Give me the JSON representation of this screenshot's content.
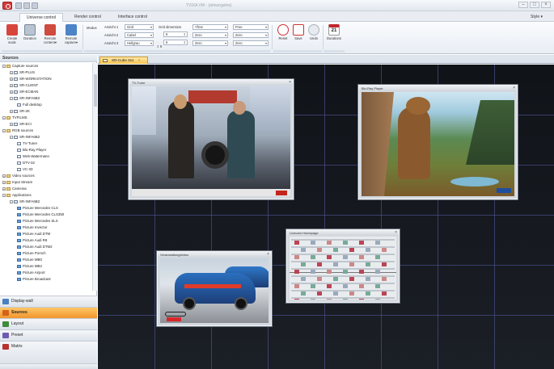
{
  "window": {
    "title": "TVIXA VM  - (ahnungslos)",
    "controls": [
      "–",
      "□",
      "×"
    ]
  },
  "tabs": [
    {
      "label": "Universe control",
      "active": true
    },
    {
      "label": "Render control",
      "active": false
    },
    {
      "label": "Interface control",
      "active": false
    }
  ],
  "style_menu": "Style ▾",
  "ribbon": {
    "buttons": [
      {
        "label": "Create scale"
      },
      {
        "label": "Duration"
      },
      {
        "label": "Remote content▾"
      },
      {
        "label": "Remote capture▾"
      }
    ],
    "settings_label": "Modus",
    "panel1": {
      "rows": [
        {
          "label": "Ansicht 1",
          "value": "Grid"
        },
        {
          "label": "Ansicht 2",
          "value": "Cabel"
        },
        {
          "label": "Ansicht 3",
          "value": "Hellgrau"
        }
      ]
    },
    "panel2": {
      "label": "Grid dimension",
      "spins": [
        "6",
        "6",
        "6"
      ]
    },
    "panel3": {
      "combos": [
        "Yfree",
        "Zero",
        "Zero"
      ]
    },
    "panel4": {
      "combos": [
        "Free",
        "Zero",
        "Zero"
      ]
    },
    "actions": [
      {
        "label": "Reset"
      },
      {
        "label": "Save"
      },
      {
        "label": "Undo"
      }
    ],
    "calendar": {
      "day": "21",
      "label": "Durations"
    }
  },
  "sidebar": {
    "header": "Sources",
    "tree": [
      {
        "depth": 0,
        "label": "Capture sources",
        "kind": "folder",
        "exp": "−"
      },
      {
        "depth": 1,
        "label": "SR-PLUS",
        "kind": "item",
        "exp": "+"
      },
      {
        "depth": 1,
        "label": "SR-WORKSTATION",
        "kind": "item",
        "exp": "+"
      },
      {
        "depth": 1,
        "label": "SR-CLIENT",
        "kind": "item",
        "exp": "+"
      },
      {
        "depth": 1,
        "label": "SR-ECMAN",
        "kind": "item",
        "exp": "+"
      },
      {
        "depth": 1,
        "label": "SR-INFA6B2",
        "kind": "item",
        "exp": "−"
      },
      {
        "depth": 2,
        "label": "Full desktop",
        "kind": "item",
        "exp": ""
      },
      {
        "depth": 1,
        "label": "SR-2K",
        "kind": "item",
        "exp": "+"
      },
      {
        "depth": 0,
        "label": "TVFILMS",
        "kind": "folder",
        "exp": "−"
      },
      {
        "depth": 1,
        "label": "SR-ECI",
        "kind": "item",
        "exp": "+"
      },
      {
        "depth": 0,
        "label": "RGB sources",
        "kind": "folder",
        "exp": "−"
      },
      {
        "depth": 1,
        "label": "SR-INFA6B2",
        "kind": "item",
        "exp": "−"
      },
      {
        "depth": 2,
        "label": "TV-Tuner",
        "kind": "item",
        "exp": ""
      },
      {
        "depth": 2,
        "label": "Blu-Ray Player",
        "kind": "item",
        "exp": ""
      },
      {
        "depth": 2,
        "label": "Web-Watermann",
        "kind": "item",
        "exp": ""
      },
      {
        "depth": 2,
        "label": "DTV-32",
        "kind": "item",
        "exp": ""
      },
      {
        "depth": 2,
        "label": "VC-33",
        "kind": "item",
        "exp": ""
      },
      {
        "depth": 0,
        "label": "Video sources",
        "kind": "folder",
        "exp": "+"
      },
      {
        "depth": 0,
        "label": "Input Stream",
        "kind": "folder",
        "exp": "+"
      },
      {
        "depth": 0,
        "label": "Cameras",
        "kind": "folder",
        "exp": "+"
      },
      {
        "depth": 0,
        "label": "Applications",
        "kind": "folder",
        "exp": "−"
      },
      {
        "depth": 1,
        "label": "SR-INFA6B2",
        "kind": "item",
        "exp": "−"
      },
      {
        "depth": 2,
        "label": "Picture Mercedes CLS",
        "kind": "pic",
        "exp": ""
      },
      {
        "depth": 2,
        "label": "Picture Mercedes CLS350",
        "kind": "pic",
        "exp": ""
      },
      {
        "depth": 2,
        "label": "Picture Mercedes SLS",
        "kind": "pic",
        "exp": ""
      },
      {
        "depth": 2,
        "label": "Picture Invector",
        "kind": "pic",
        "exp": ""
      },
      {
        "depth": 2,
        "label": "Picture Audi DTM",
        "kind": "pic",
        "exp": ""
      },
      {
        "depth": 2,
        "label": "Picture Audi R8",
        "kind": "pic",
        "exp": ""
      },
      {
        "depth": 2,
        "label": "Picture Audi DTM2",
        "kind": "pic",
        "exp": ""
      },
      {
        "depth": 2,
        "label": "Picture Porsch",
        "kind": "pic",
        "exp": ""
      },
      {
        "depth": 2,
        "label": "Picture MB0",
        "kind": "pic",
        "exp": ""
      },
      {
        "depth": 2,
        "label": "Picture MB2",
        "kind": "pic",
        "exp": ""
      },
      {
        "depth": 2,
        "label": "Picture Airport",
        "kind": "pic",
        "exp": ""
      },
      {
        "depth": 2,
        "label": "Picture Broadcast",
        "kind": "pic",
        "exp": ""
      }
    ],
    "nav": [
      {
        "label": "Display-wall",
        "active": false,
        "color": "#4a7fc1"
      },
      {
        "label": "Sources",
        "active": true,
        "color": "#d5611b"
      },
      {
        "label": "Layout",
        "active": false,
        "color": "#3f8a3b"
      },
      {
        "label": "Preset",
        "active": false,
        "color": "#6d5bb2"
      },
      {
        "label": "Matrix",
        "active": false,
        "color": "#b8322f"
      }
    ]
  },
  "document_tab": {
    "label": "SR-Cube 3x1",
    "close": "×"
  },
  "canvas": {
    "windows": [
      {
        "id": "tv",
        "title": "TV-Tuner"
      },
      {
        "id": "bluray",
        "title": "Blu-Ray Player"
      },
      {
        "id": "web",
        "title": "Livecam Homepage"
      },
      {
        "id": "audi",
        "title": "Veranstaltungsfotos"
      }
    ]
  },
  "colors": {
    "accent": "#f0952e",
    "canvas_bg": "#141820",
    "grid_line": "#4a4f8c"
  }
}
